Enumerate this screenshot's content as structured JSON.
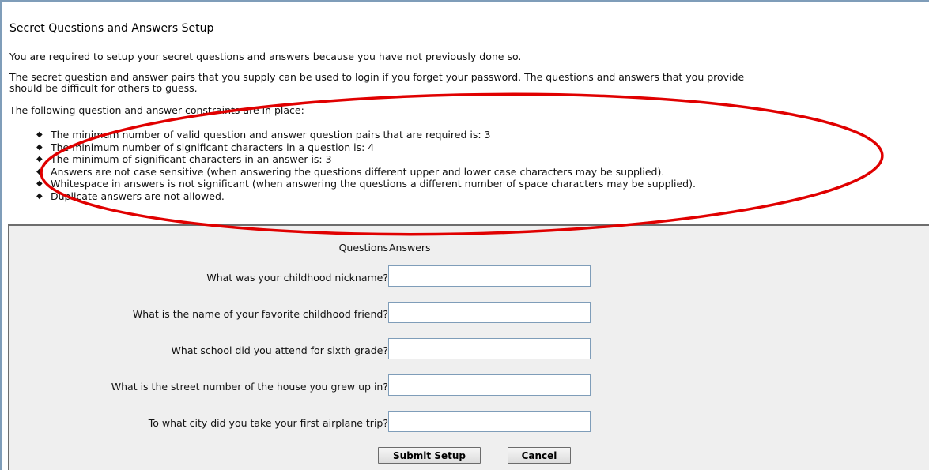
{
  "page": {
    "title": "Secret Questions and Answers Setup",
    "intro_required": "You are required to setup your secret questions and answers because you have not previously done so.",
    "intro_pairs_line1": "The secret question and answer pairs that you supply can be used to login if you forget your password. The questions and answers that you provide",
    "intro_pairs_line2": "should be difficult for others to guess.",
    "constraints_heading": "The following question and answer constraints are in place:"
  },
  "constraints": [
    "The minimum number of valid question and answer question pairs that are required is: 3",
    "The minimum number of significant characters in a question is: 4",
    "The minimum of significant characters in an answer is: 3",
    "Answers are not case sensitive (when answering the questions different upper and lower case characters may be supplied).",
    "Whitespace in answers is not significant (when answering the questions a different number of space characters may be supplied).",
    "Duplicate answers are not allowed."
  ],
  "form": {
    "questions_header": "Questions",
    "answers_header": "Answers",
    "rows": [
      {
        "question": "What was your childhood nickname?",
        "answer": ""
      },
      {
        "question": "What is the name of your favorite childhood friend?",
        "answer": ""
      },
      {
        "question": "What school did you attend for sixth grade?",
        "answer": ""
      },
      {
        "question": "What is the street number of the house you grew up in?",
        "answer": ""
      },
      {
        "question": "To what city did you take your first airplane trip?",
        "answer": ""
      }
    ],
    "submit_label": "Submit Setup",
    "cancel_label": "Cancel"
  },
  "colors": {
    "annotation_ellipse": "#e00000",
    "form_background": "#efefef",
    "input_border": "#7f9db9"
  }
}
